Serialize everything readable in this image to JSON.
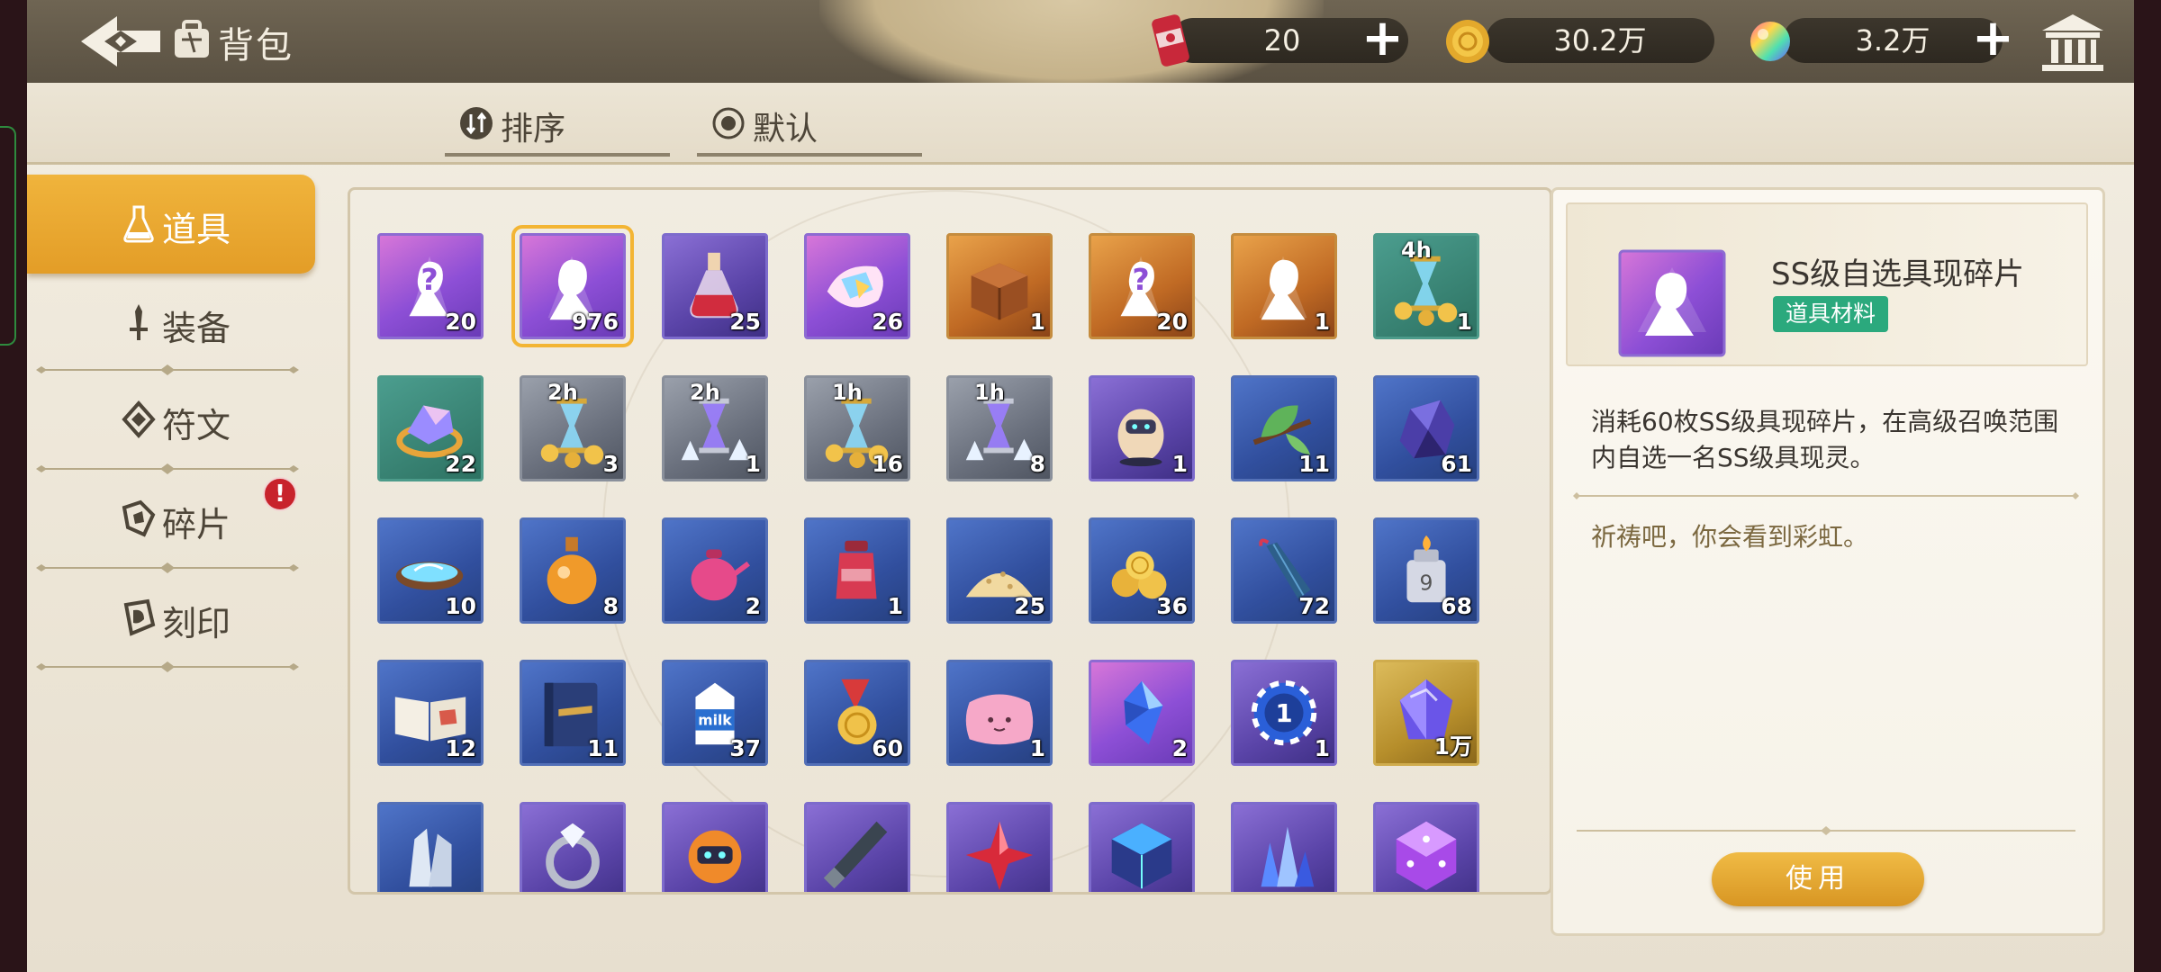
{
  "header": {
    "title": "背包",
    "resources": [
      {
        "name": "stamina-drink",
        "value": "20",
        "has_plus": true
      },
      {
        "name": "gold-coin",
        "value": "30.2万",
        "has_plus": false
      },
      {
        "name": "rainbow-gem",
        "value": "3.2万",
        "has_plus": true
      }
    ]
  },
  "tabs": [
    {
      "label": "排序",
      "icon": "sort-icon"
    },
    {
      "label": "默认",
      "icon": "radio-icon"
    }
  ],
  "sidebar": {
    "items": [
      {
        "label": "道具",
        "icon": "potion-icon",
        "active": true
      },
      {
        "label": "装备",
        "icon": "sword-icon",
        "active": false
      },
      {
        "label": "符文",
        "icon": "rune-icon",
        "active": false
      },
      {
        "label": "碎片",
        "icon": "shard-icon",
        "active": false,
        "alert": "!"
      },
      {
        "label": "刻印",
        "icon": "seal-icon",
        "active": false
      }
    ]
  },
  "items": [
    {
      "rarity": "ss",
      "art": "mystery-figure",
      "count": "20"
    },
    {
      "rarity": "ss",
      "art": "figure-silhouette",
      "count": "976",
      "selected": true
    },
    {
      "rarity": "a",
      "art": "red-potion",
      "count": "25"
    },
    {
      "rarity": "ss",
      "art": "crystal-shard",
      "count": "26"
    },
    {
      "rarity": "s",
      "art": "wooden-crate",
      "count": "1"
    },
    {
      "rarity": "s",
      "art": "mystery-figure",
      "count": "20"
    },
    {
      "rarity": "s",
      "art": "figure-silhouette",
      "count": "1"
    },
    {
      "rarity": "c",
      "art": "hourglass-coins",
      "count": "1",
      "timer": "4h"
    },
    {
      "rarity": "c",
      "art": "crystal-ring",
      "count": "22"
    },
    {
      "rarity": "g",
      "art": "hourglass-coins",
      "count": "3",
      "timer": "2h"
    },
    {
      "rarity": "g",
      "art": "hourglass-crystal",
      "count": "1",
      "timer": "2h"
    },
    {
      "rarity": "g",
      "art": "hourglass-coins",
      "count": "16",
      "timer": "1h"
    },
    {
      "rarity": "g",
      "art": "hourglass-crystal",
      "count": "8",
      "timer": "1h"
    },
    {
      "rarity": "a",
      "art": "robot-egg",
      "count": "1"
    },
    {
      "rarity": "b",
      "art": "leaf-branch",
      "count": "11"
    },
    {
      "rarity": "b",
      "art": "dark-ore",
      "count": "61"
    },
    {
      "rarity": "b",
      "art": "water-bowl",
      "count": "10"
    },
    {
      "rarity": "b",
      "art": "orange-flask",
      "count": "8"
    },
    {
      "rarity": "b",
      "art": "pink-teapot",
      "count": "2"
    },
    {
      "rarity": "b",
      "art": "red-jar",
      "count": "1"
    },
    {
      "rarity": "b",
      "art": "grain-pile",
      "count": "25"
    },
    {
      "rarity": "b",
      "art": "gold-pile",
      "count": "36"
    },
    {
      "rarity": "b",
      "art": "umbrella",
      "count": "72"
    },
    {
      "rarity": "b",
      "art": "lighter",
      "count": "68"
    },
    {
      "rarity": "b",
      "art": "open-book",
      "count": "12"
    },
    {
      "rarity": "b",
      "art": "closed-book",
      "count": "11"
    },
    {
      "rarity": "b",
      "art": "milk-carton",
      "count": "37"
    },
    {
      "rarity": "b",
      "art": "medal",
      "count": "60"
    },
    {
      "rarity": "b",
      "art": "pink-pillow",
      "count": "1"
    },
    {
      "rarity": "ss",
      "art": "blue-crystal",
      "count": "2"
    },
    {
      "rarity": "a",
      "art": "blue-chip",
      "count": "1"
    },
    {
      "rarity": "gold",
      "art": "purple-gem",
      "count": "1万"
    },
    {
      "rarity": "b",
      "art": "white-crystal",
      "count": ""
    },
    {
      "rarity": "a",
      "art": "diamond-ring",
      "count": ""
    },
    {
      "rarity": "a",
      "art": "orange-robot",
      "count": ""
    },
    {
      "rarity": "a",
      "art": "dark-blade",
      "count": ""
    },
    {
      "rarity": "a",
      "art": "red-crystal",
      "count": ""
    },
    {
      "rarity": "a",
      "art": "cyber-cube",
      "count": ""
    },
    {
      "rarity": "a",
      "art": "blue-crystal-cluster",
      "count": ""
    },
    {
      "rarity": "a",
      "art": "purple-die",
      "count": ""
    }
  ],
  "detail": {
    "name": "SS级自选具现碎片",
    "tag": "道具材料",
    "description": "消耗60枚SS级具现碎片，在高级召唤范围内自选一名SS级具现灵。",
    "flavor": "祈祷吧，你会看到彩虹。",
    "use_button": "使用"
  },
  "colors": {
    "accent": "#e9a52d",
    "tag": "#2ba97d",
    "alert": "#c8232c"
  }
}
